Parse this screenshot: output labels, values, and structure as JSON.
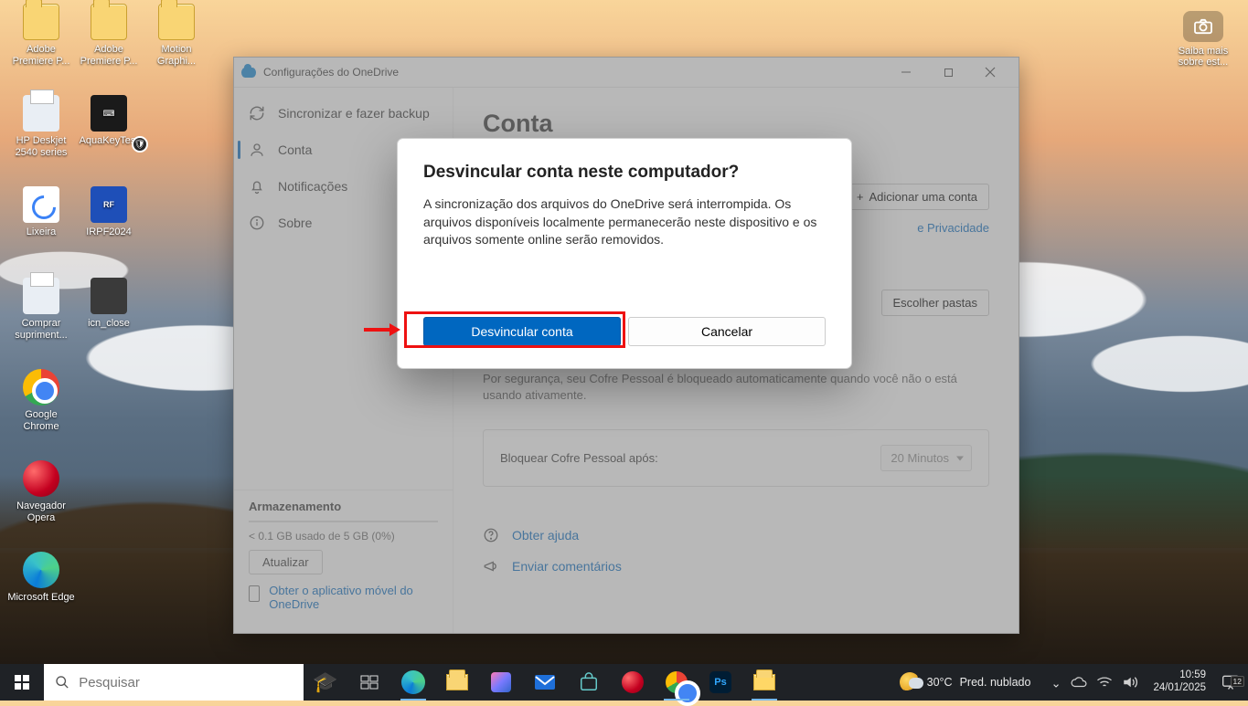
{
  "desktop_icons": {
    "r0c0": "Adobe Premiere P...",
    "r0c1": "Adobe Premiere P...",
    "r0c2": "Motion Graphi...",
    "r1c0": "HP Deskjet 2540 series",
    "r1c1": "AquaKeyTest",
    "r2c0": "Lixeira",
    "r2c1": "IRPF2024",
    "r3c0": "Comprar supriment...",
    "r3c1": "icn_close",
    "r4c0": "Google Chrome",
    "r5c0": "Navegador Opera",
    "r6c0": "Microsoft Edge"
  },
  "know_more": {
    "line1": "Saiba mais",
    "line2": "sobre est..."
  },
  "window": {
    "title": "Configurações do OneDrive",
    "sidebar": {
      "items": [
        {
          "label": "Sincronizar e fazer backup"
        },
        {
          "label": "Conta"
        },
        {
          "label": "Notificações"
        },
        {
          "label": "Sobre"
        }
      ],
      "storage": {
        "heading": "Armazenamento",
        "usage": "< 0.1 GB usado de 5 GB (0%)",
        "update_btn": "Atualizar",
        "mobile_link": "Obter o aplicativo móvel do OneDrive"
      }
    },
    "content": {
      "heading": "Conta",
      "add_account_btn": "Adicionar uma conta",
      "privacy_fragment": "e Privacidade",
      "choose_folders_btn": "Escolher pastas",
      "vault_text": "Por segurança, seu Cofre Pessoal é bloqueado automaticamente quando você não o está usando ativamente.",
      "lock_label": "Bloquear Cofre Pessoal após:",
      "lock_value": "20 Minutos",
      "help_link": "Obter ajuda",
      "feedback_link": "Enviar comentários"
    }
  },
  "modal": {
    "title": "Desvincular conta neste computador?",
    "body": "A sincronização dos arquivos do OneDrive será interrompida. Os arquivos disponíveis localmente permanecerão neste dispositivo e os arquivos somente online serão removidos.",
    "primary_btn": "Desvincular conta",
    "secondary_btn": "Cancelar"
  },
  "taskbar": {
    "search_placeholder": "Pesquisar",
    "weather_temp": "30°C",
    "weather_desc": "Pred. nublado",
    "time": "10:59",
    "date": "24/01/2025",
    "notif_badge": "12"
  }
}
